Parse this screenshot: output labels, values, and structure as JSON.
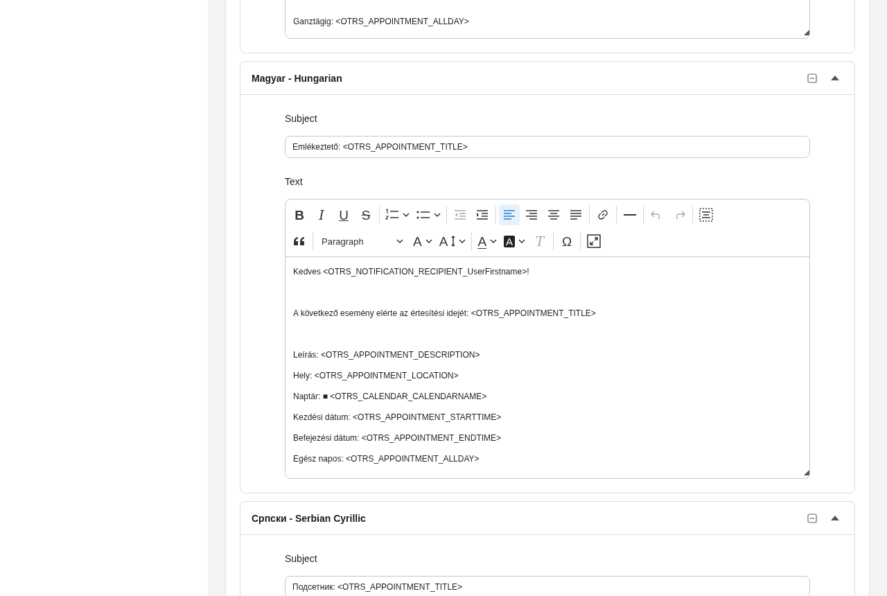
{
  "cards": [
    {
      "editor": {
        "lines": [
          {
            "text": "Ganztägig: <OTRS_APPOINTMENT_ALLDAY>"
          }
        ]
      }
    },
    {
      "title": "Magyar - Hungarian",
      "expanded": true,
      "subject_label": "Subject",
      "subject_value": "Emlékeztető: <OTRS_APPOINTMENT_TITLE>",
      "text_label": "Text",
      "editor": {
        "toolbar": [
          {
            "items": [
              {
                "kind": "bold",
                "glyph": "B",
                "selected": false,
                "disabled": false
              },
              {
                "kind": "italic",
                "glyph": "I",
                "selected": false,
                "disabled": false
              },
              {
                "kind": "underline",
                "glyph": "U",
                "selected": false,
                "disabled": false
              },
              {
                "kind": "strikethrough",
                "glyph": "S",
                "selected": false,
                "disabled": false,
                "separator_after": true
              },
              {
                "kind": "numbered-list",
                "dropdown": true,
                "selected": false,
                "disabled": false
              },
              {
                "kind": "bulleted-list",
                "dropdown": true,
                "selected": false,
                "disabled": false,
                "separator_after": true
              },
              {
                "kind": "outdent",
                "selected": false,
                "disabled": true
              },
              {
                "kind": "indent",
                "selected": false,
                "disabled": false,
                "separator_after": true
              },
              {
                "kind": "align-left",
                "selected": true,
                "disabled": false
              },
              {
                "kind": "align-right",
                "selected": false,
                "disabled": false
              },
              {
                "kind": "align-center",
                "selected": false,
                "disabled": false
              },
              {
                "kind": "justify",
                "selected": false,
                "disabled": false,
                "separator_after": true
              },
              {
                "kind": "link",
                "selected": false,
                "disabled": false,
                "separator_after": true
              },
              {
                "kind": "horizontal-line",
                "selected": false,
                "disabled": false,
                "separator_after": true
              },
              {
                "kind": "undo",
                "selected": false,
                "disabled": true
              },
              {
                "kind": "redo",
                "selected": false,
                "disabled": true,
                "separator_after": true
              },
              {
                "kind": "select-all",
                "selected": false,
                "disabled": false
              }
            ]
          },
          {
            "items": [
              {
                "kind": "blockquote",
                "selected": false,
                "disabled": false,
                "separator_after": true
              },
              {
                "kind": "heading-select",
                "label": "Paragraph",
                "dropdown": true,
                "selected": false,
                "disabled": false
              },
              {
                "kind": "font-size",
                "glyph": "A",
                "dropdown": true,
                "selected": false,
                "disabled": false
              },
              {
                "kind": "line-height",
                "glyph": "A",
                "dropdown": true,
                "selected": false,
                "disabled": false,
                "separator_after": true
              },
              {
                "kind": "font-color",
                "glyph": "A",
                "dropdown": true,
                "selected": false,
                "disabled": false
              },
              {
                "kind": "background-color",
                "glyph": "A",
                "dropdown": true,
                "selected": false,
                "disabled": false
              },
              {
                "kind": "remove-format",
                "glyph": "T",
                "selected": false,
                "disabled": true,
                "separator_after": true
              },
              {
                "kind": "special-characters",
                "glyph": "Ω",
                "selected": false,
                "disabled": false,
                "separator_after": true
              },
              {
                "kind": "fullscreen",
                "selected": false,
                "disabled": false
              }
            ]
          }
        ],
        "lines": [
          {
            "text": "Kedves <OTRS_NOTIFICATION_RECIPIENT_UserFirstname>!",
            "spaced": true
          },
          {
            "text": "A következő esemény elérte az értesítési idejét: <OTRS_APPOINTMENT_TITLE>",
            "spaced": true
          },
          {
            "text": "Leírás: <OTRS_APPOINTMENT_DESCRIPTION>"
          },
          {
            "text": "Hely: <OTRS_APPOINTMENT_LOCATION>"
          },
          {
            "text": "Naptár: ■ <OTRS_CALENDAR_CALENDARNAME>"
          },
          {
            "text": "Kezdési dátum: <OTRS_APPOINTMENT_STARTTIME>"
          },
          {
            "text": "Befejezési dátum: <OTRS_APPOINTMENT_ENDTIME>"
          },
          {
            "text": "Egész napos: <OTRS_APPOINTMENT_ALLDAY>"
          }
        ]
      }
    },
    {
      "title": "Српски - Serbian Cyrillic",
      "expanded": true,
      "subject_label": "Subject",
      "subject_value": "Подсетник: <OTRS_APPOINTMENT_TITLE>"
    }
  ]
}
